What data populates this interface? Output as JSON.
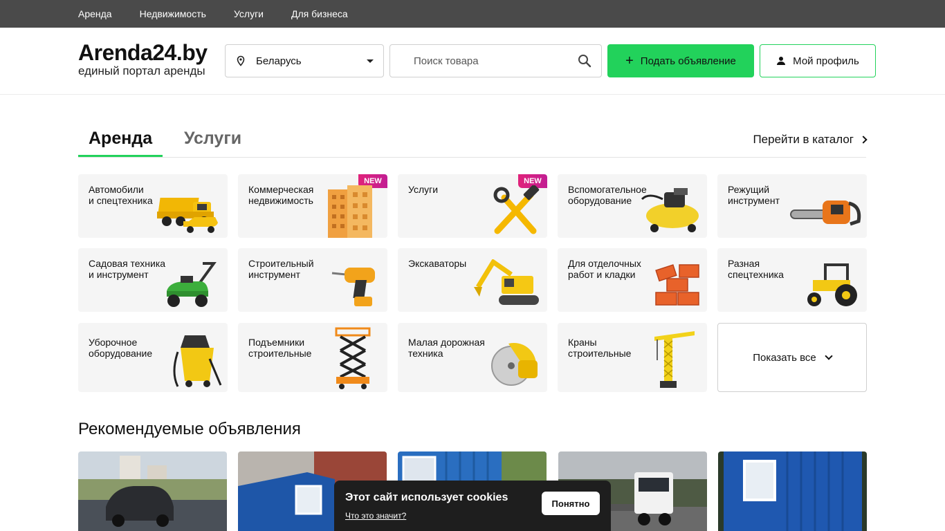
{
  "topnav": [
    "Аренда",
    "Недвижимость",
    "Услуги",
    "Для бизнеса"
  ],
  "logo": {
    "title": "Arenda24.by",
    "subtitle": "единый портал аренды"
  },
  "region": {
    "value": "Беларусь"
  },
  "search": {
    "placeholder": "Поиск товара"
  },
  "buttons": {
    "post": "Подать объявление",
    "profile": "Мой профиль"
  },
  "tabs": {
    "rent": "Аренда",
    "services": "Услуги",
    "catalog": "Перейти в каталог"
  },
  "categories": [
    {
      "label": "Автомобили\nи спецтехника",
      "icon": "dump-truck-icon",
      "badge": ""
    },
    {
      "label": "Коммерческая\nнедвижимость",
      "icon": "building-icon",
      "badge": "NEW"
    },
    {
      "label": "Услуги",
      "icon": "hammer-wrench-icon",
      "badge": "NEW"
    },
    {
      "label": "Вспомогательное\nоборудование",
      "icon": "compressor-icon",
      "badge": ""
    },
    {
      "label": "Режущий\nинструмент",
      "icon": "chainsaw-icon",
      "badge": ""
    },
    {
      "label": "Садовая техника\nи инструмент",
      "icon": "lawnmower-icon",
      "badge": ""
    },
    {
      "label": "Строительный\nинструмент",
      "icon": "drill-icon",
      "badge": ""
    },
    {
      "label": "Экскаваторы",
      "icon": "excavator-icon",
      "badge": ""
    },
    {
      "label": "Для отделочных\nработ и кладки",
      "icon": "bricks-icon",
      "badge": ""
    },
    {
      "label": "Разная\nспецтехника",
      "icon": "tractor-icon",
      "badge": ""
    },
    {
      "label": "Уборочное\nоборудование",
      "icon": "vacuum-icon",
      "badge": ""
    },
    {
      "label": "Подъемники\nстроительные",
      "icon": "scissor-lift-icon",
      "badge": ""
    },
    {
      "label": "Малая дорожная\nтехника",
      "icon": "concrete-saw-icon",
      "badge": ""
    },
    {
      "label": "Краны\nстроительные",
      "icon": "crane-icon",
      "badge": ""
    }
  ],
  "show_all": "Показать все",
  "recommended": {
    "title": "Рекомендуемые объявления"
  },
  "cookie": {
    "title": "Этот сайт использует cookies",
    "link": "Что это значит?",
    "button": "Понятно"
  },
  "colors": {
    "accent": "#22d25b",
    "topbar": "#4a4a4a",
    "badge": "#d4207f"
  }
}
